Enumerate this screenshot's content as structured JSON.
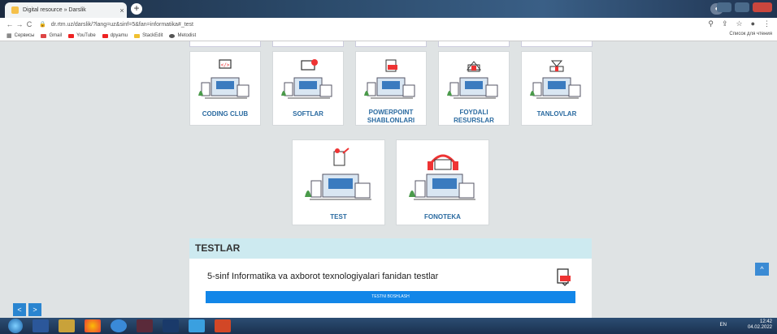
{
  "browser": {
    "tab_title": "Digital resource » Darslik",
    "tab_close": "×",
    "new_tab": "+",
    "url": "dr.rtm.uz/darslik/?lang=uz&sinf=5&fan=informatika#_test",
    "back": "←",
    "forward": "→",
    "reload": "C",
    "bookmarks": [
      "Сервисы",
      "Gmail",
      "YouTube",
      "dpyamu",
      "StackEdit",
      "Metodist"
    ],
    "reading_list": "Список для чтения"
  },
  "cards_row1": [
    "CODING CLUB",
    "SOFTLAR",
    "POWERPOINT\nSHABLONLARI",
    "FOYDALI\nRESURSLAR",
    "TANLOVLAR"
  ],
  "cards_row2": [
    "TEST",
    "FONOTEKA"
  ],
  "testlar": {
    "header": "TESTLAR",
    "title": "5-sinf Informatika va axborot texnologiyalari fanidan testlar",
    "button": "TESTNI BOSHLASH"
  },
  "pagination": {
    "prev": "<",
    "next": ">"
  },
  "scroll_top": "^",
  "taskbar": {
    "lang": "EN",
    "time": "12:42",
    "date": "04.02.2022"
  },
  "colors": {
    "accent": "#1286e8",
    "label": "#2a6aa0",
    "header_bg": "#cdeaf0"
  }
}
